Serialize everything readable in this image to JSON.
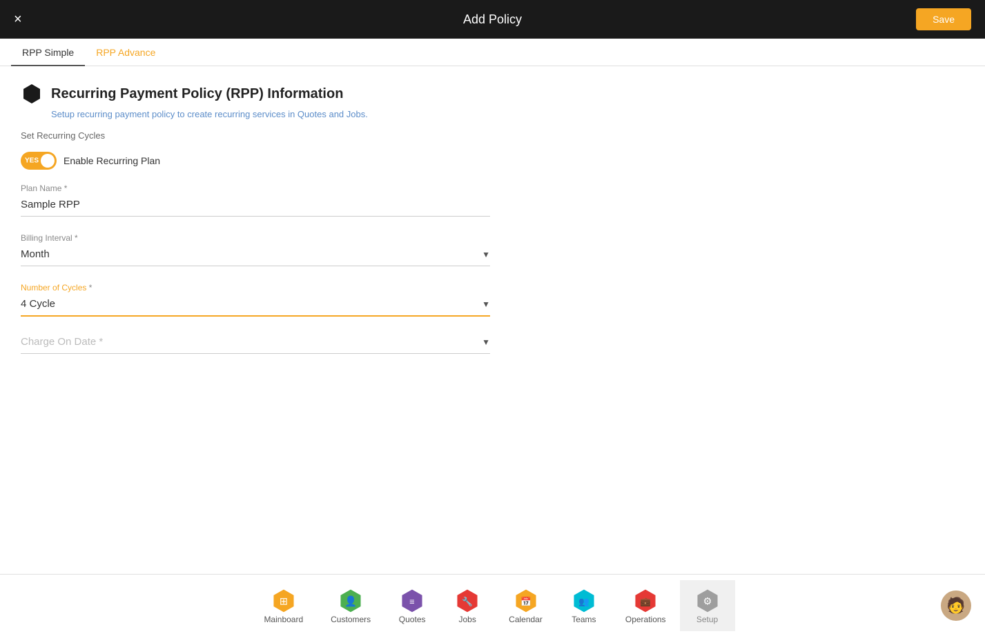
{
  "header": {
    "title": "Add Policy",
    "close_label": "×",
    "save_label": "Save"
  },
  "tabs": [
    {
      "id": "rpp-simple",
      "label": "RPP Simple",
      "active": true
    },
    {
      "id": "rpp-advance",
      "label": "RPP Advance",
      "active": false
    }
  ],
  "section": {
    "icon_color": "#1a1a1a",
    "title": "Recurring Payment Policy (RPP) Information",
    "subtitle": "Setup recurring payment policy to create recurring services in Quotes and Jobs.",
    "set_recurring_label": "Set Recurring Cycles"
  },
  "form": {
    "toggle_yes": "YES",
    "toggle_label": "Enable Recurring Plan",
    "plan_name_label": "Plan Name *",
    "plan_name_value": "Sample RPP",
    "billing_interval_label": "Billing Interval *",
    "billing_interval_value": "Month",
    "number_of_cycles_label": "Number of Cycles *",
    "number_of_cycles_value": "4 Cycle",
    "charge_on_date_label": "Charge On Date *",
    "charge_on_date_placeholder": "Charge On Date *"
  },
  "bottom_nav": {
    "items": [
      {
        "id": "mainboard",
        "label": "Mainboard",
        "icon_color": "#f5a623",
        "icon": "⬡"
      },
      {
        "id": "customers",
        "label": "Customers",
        "icon_color": "#4caf50",
        "icon": "👤"
      },
      {
        "id": "quotes",
        "label": "Quotes",
        "icon_color": "#7b52ab",
        "icon": "📋"
      },
      {
        "id": "jobs",
        "label": "Jobs",
        "icon_color": "#e53935",
        "icon": "🔧"
      },
      {
        "id": "calendar",
        "label": "Calendar",
        "icon_color": "#f5a623",
        "icon": "📅"
      },
      {
        "id": "teams",
        "label": "Teams",
        "icon_color": "#00bcd4",
        "icon": "👥"
      },
      {
        "id": "operations",
        "label": "Operations",
        "icon_color": "#e53935",
        "icon": "💼"
      },
      {
        "id": "setup",
        "label": "Setup",
        "icon_color": "#9e9e9e",
        "icon": "⚙",
        "active": true
      }
    ]
  },
  "colors": {
    "header_bg": "#1a1a1a",
    "accent_orange": "#f5a623",
    "tab_active": "#555555",
    "tab_inactive_orange": "#f5a623",
    "active_nav_bg": "#f0f0f0"
  }
}
